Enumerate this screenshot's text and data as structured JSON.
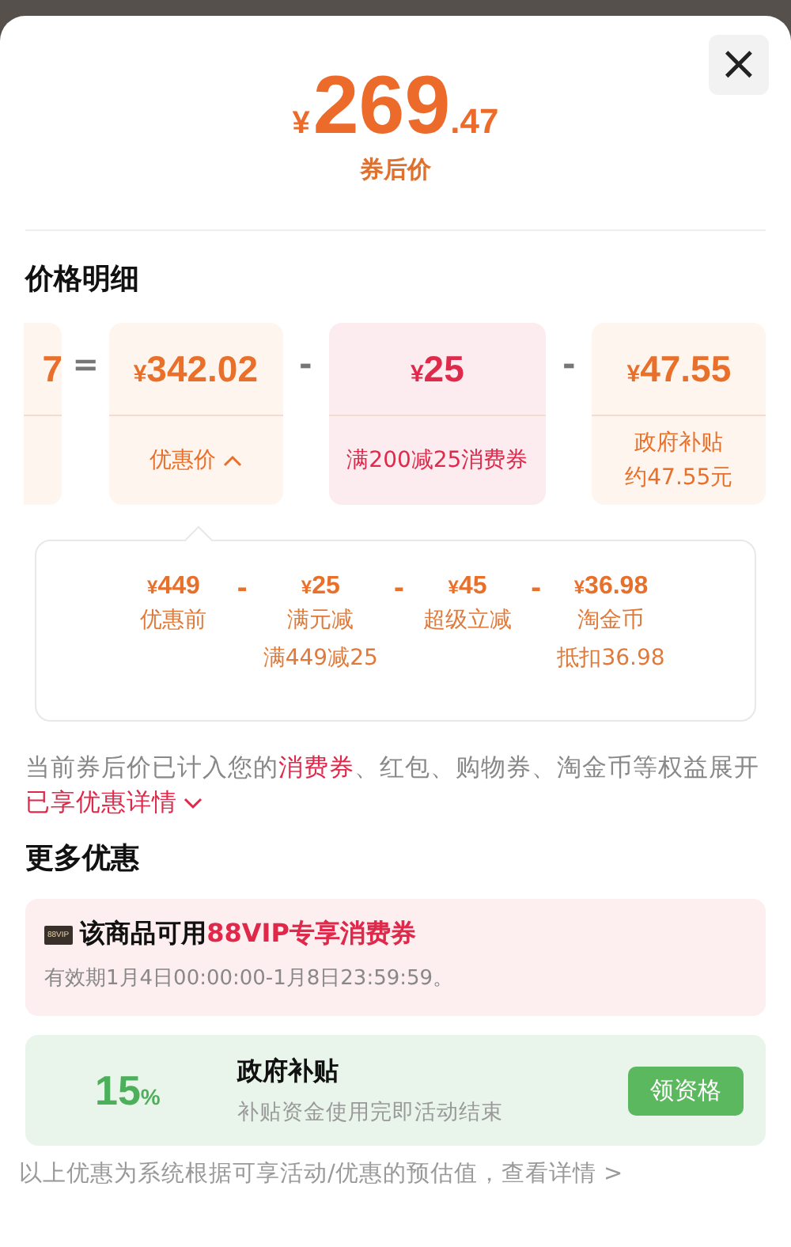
{
  "close_label": "×",
  "price": {
    "currency": "¥",
    "integer": "269",
    "decimal": ".47",
    "label": "券后价"
  },
  "breakdown": {
    "title": "价格明细",
    "cards": [
      {
        "kind": "price",
        "amount": "7"
      },
      {
        "kind": "price",
        "op": "=",
        "currency": "¥",
        "amount": "342.02",
        "label": "优惠价",
        "expanded": true
      },
      {
        "kind": "coupon",
        "op": "-",
        "currency": "¥",
        "amount": "25",
        "label": "满200减25消费券"
      },
      {
        "kind": "price",
        "op": "-",
        "currency": "¥",
        "amount": "47.55",
        "label": "政府补贴",
        "sublabel": "约47.55元"
      }
    ],
    "popover": [
      {
        "currency": "¥",
        "amount": "449",
        "label": "优惠前"
      },
      {
        "op": "-",
        "currency": "¥",
        "amount": "25",
        "label": "满元减",
        "sublabel": "满449减25"
      },
      {
        "op": "-",
        "currency": "¥",
        "amount": "45",
        "label": "超级立减"
      },
      {
        "op": "-",
        "currency": "¥",
        "amount": "36.98",
        "label": "淘金币",
        "sublabel": "抵扣36.98"
      }
    ]
  },
  "note": {
    "segments": [
      {
        "text": "当前券后价已计入您的",
        "highlight": false
      },
      {
        "text": "消费券",
        "highlight": true
      },
      {
        "text": "、红包、购物券、淘金币等权益展开",
        "highlight": false
      }
    ],
    "link": "已享优惠详情",
    "expanded": false
  },
  "more": {
    "title": "更多优惠",
    "vip": {
      "badge": "88VIP",
      "title": "该商品可用",
      "title_highlight": "88VIP专享消费券",
      "validity": "有效期1月4日00:00:00-1月8日23:59:59。"
    },
    "subsidy": {
      "percent": "15",
      "unit": "%",
      "title": "政府补贴",
      "desc": "补贴资金使用完即活动结束",
      "button": "领资格"
    }
  },
  "footer": {
    "text": "以上优惠为系统根据可享活动/优惠的预估值，",
    "link": "查看详情 >"
  }
}
